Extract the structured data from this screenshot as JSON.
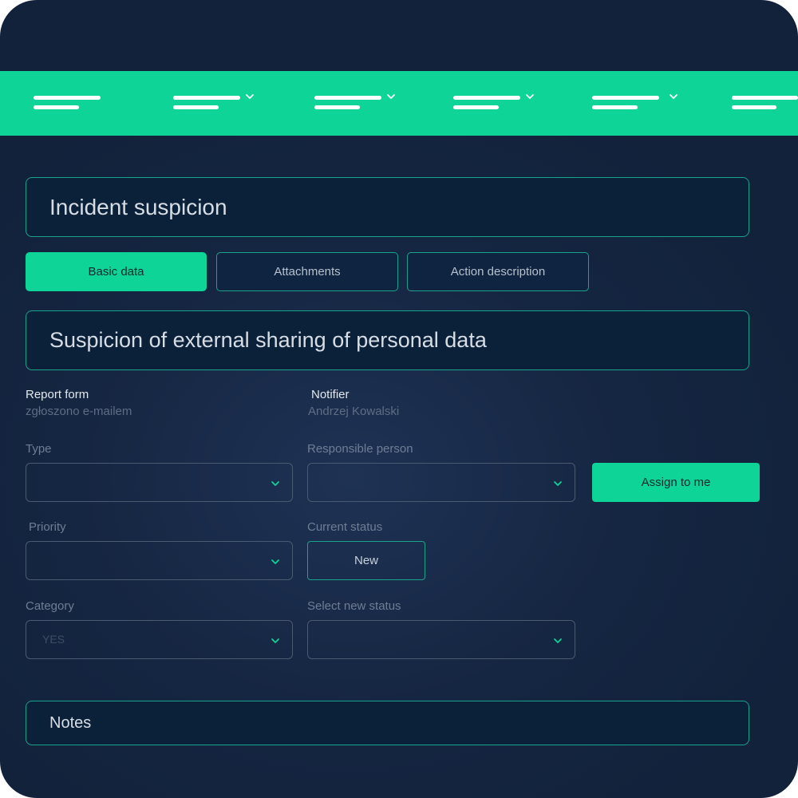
{
  "colors": {
    "accent": "#0ed497",
    "background": "#152642",
    "panel": "#0b2039",
    "border": "#1aa38a"
  },
  "nav": {
    "items": [
      {
        "icon": "menu-lines-icon"
      },
      {
        "icon": "menu-lines-icon",
        "dropdown_icon": "chevron-down-icon"
      },
      {
        "icon": "menu-lines-icon",
        "dropdown_icon": "chevron-down-icon"
      },
      {
        "icon": "menu-lines-icon",
        "dropdown_icon": "chevron-down-icon"
      },
      {
        "icon": "menu-lines-icon",
        "dropdown_icon": "chevron-down-icon"
      },
      {
        "icon": "menu-lines-icon"
      }
    ]
  },
  "page": {
    "title": "Incident suspicion"
  },
  "tabs": [
    {
      "label": "Basic data",
      "active": true
    },
    {
      "label": "Attachments",
      "active": false
    },
    {
      "label": "Action description",
      "active": false
    }
  ],
  "subject": "Suspicion of external sharing of personal data",
  "info": {
    "report_form": {
      "title": "Report form",
      "value": "zgłoszono e-mailem"
    },
    "notifier": {
      "title": "Notifier",
      "value": "Andrzej Kowalski"
    }
  },
  "form": {
    "type": {
      "label": "Type",
      "value": ""
    },
    "responsible": {
      "label": "Responsible person",
      "value": ""
    },
    "assign_button": "Assign to me",
    "priority": {
      "label": "Priority",
      "value": ""
    },
    "current_status": {
      "label": "Current status",
      "value": "New"
    },
    "category": {
      "label": "Category",
      "value": "YES"
    },
    "new_status": {
      "label": "Select new status",
      "value": ""
    }
  },
  "notes": {
    "label": "Notes"
  }
}
